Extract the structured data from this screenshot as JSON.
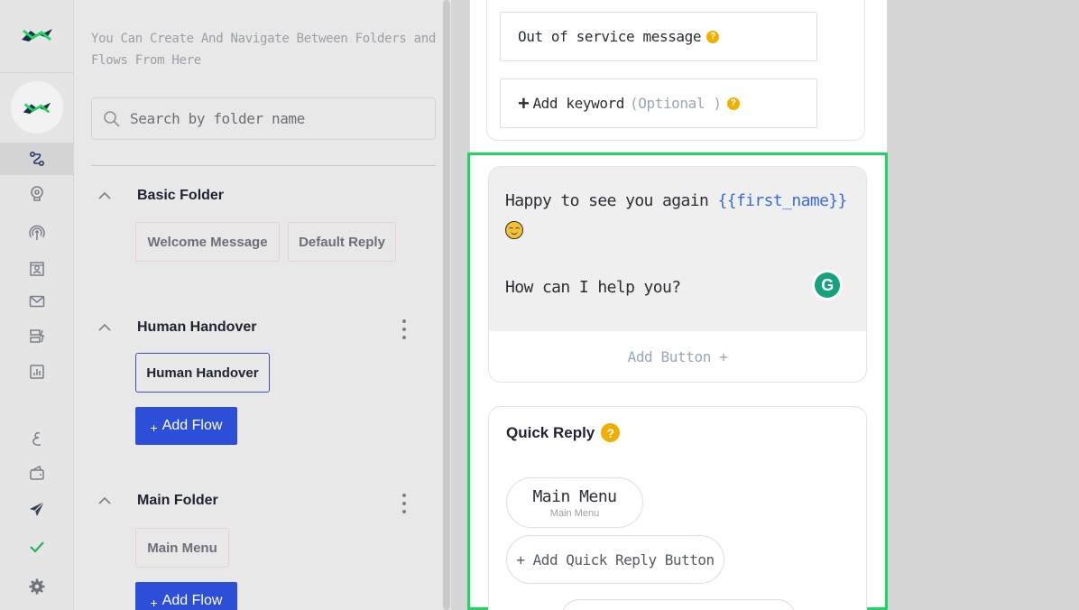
{
  "sidebar": {
    "description": "You Can Create And Navigate Between Folders and Flows From Here",
    "search_placeholder": "Search by folder name",
    "folders": [
      {
        "name": "Basic Folder",
        "flows": [
          "Welcome Message",
          "Default Reply"
        ]
      },
      {
        "name": "Human Handover",
        "flows": [
          "Human Handover"
        ],
        "add_flow": "Add Flow"
      },
      {
        "name": "Main Folder",
        "flows": [
          "Main Menu"
        ],
        "add_flow": "Add Flow"
      }
    ],
    "add_flow_plus": "+"
  },
  "rail": {
    "icons": [
      "logo-icon",
      "avatar-logo-icon",
      "flows-icon",
      "bot-icon",
      "broadcast-icon",
      "contacts-icon",
      "mail-icon",
      "automation-icon",
      "analytics-icon",
      "language-icon",
      "wallet-icon",
      "send-icon",
      "check-icon",
      "settings-icon"
    ]
  },
  "editor": {
    "out_of_service": "Out of service message",
    "add_keyword": "Add keyword",
    "optional": "(Optional )",
    "message_line1": "Happy to see you again",
    "message_var": "{{first_name}}",
    "message_line2": "How can I help you?",
    "add_button": "Add Button +",
    "quick_reply_title": "Quick Reply",
    "quick_reply_button_title": "Main Menu",
    "quick_reply_button_sub": "Main Menu",
    "add_quick_reply": "+ Add Quick Reply Button",
    "help_mark": "?",
    "grammarly_letter": "G",
    "plus": "+"
  },
  "colors": {
    "primary": "#2d4fd8",
    "highlight": "#1ed760",
    "variable": "#3d6bd9",
    "help": "#f1b000"
  }
}
